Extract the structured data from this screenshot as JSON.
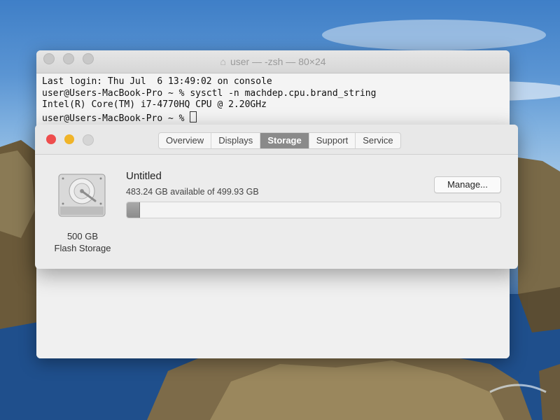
{
  "terminal": {
    "title": "user — -zsh — 80×24",
    "lines": [
      "Last login: Thu Jul  6 13:49:02 on console",
      "user@Users-MacBook-Pro ~ % sysctl -n machdep.cpu.brand_string",
      "Intel(R) Core(TM) i7-4770HQ CPU @ 2.20GHz",
      "user@Users-MacBook-Pro ~ % "
    ]
  },
  "about": {
    "tabs": [
      "Overview",
      "Displays",
      "Storage",
      "Support",
      "Service"
    ],
    "active_tab": "Storage",
    "disk": {
      "capacity": "500 GB",
      "type": "Flash Storage",
      "icon": "hard-drive-icon"
    },
    "volume": {
      "name": "Untitled",
      "space": "483.24 GB available of 499.93 GB",
      "used_fraction": 0.033
    },
    "manage_label": "Manage..."
  },
  "colors": {
    "close": "#ee4d4d",
    "minimize": "#f0b429",
    "active_tab": "#8a8a8a"
  }
}
